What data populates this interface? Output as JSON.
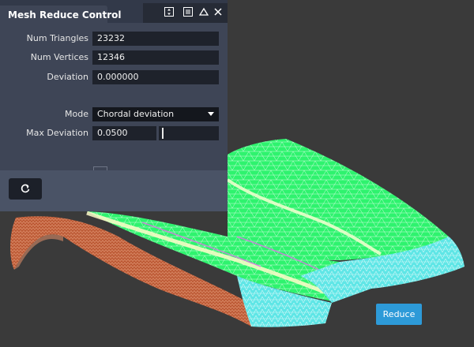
{
  "panel": {
    "title": "Mesh Reduce Control",
    "controls": [
      {
        "name": "collapse-icon"
      },
      {
        "name": "menu-icon"
      },
      {
        "name": "triangle-icon"
      },
      {
        "name": "close-icon"
      }
    ],
    "rows": {
      "num_triangles": {
        "label": "Num Triangles",
        "value": "23232"
      },
      "num_vertices": {
        "label": "Num Vertices",
        "value": "12346"
      },
      "deviation": {
        "label": "Deviation",
        "value": "0.000000"
      },
      "mode": {
        "label": "Mode",
        "value": "Chordal deviation"
      },
      "max_deviation": {
        "label": "Max Deviation",
        "value": "0.0500",
        "slider_fraction": 0.05
      }
    },
    "reset_icon": "reset-icon"
  },
  "reduce_button": {
    "label": "Reduce"
  },
  "colors": {
    "panel_bg": "#3e4556",
    "accent": "#2d9ad8",
    "mesh_green": "#2ef36e",
    "mesh_cyan": "#4ee7e8",
    "mesh_copper": "#c2603c"
  }
}
